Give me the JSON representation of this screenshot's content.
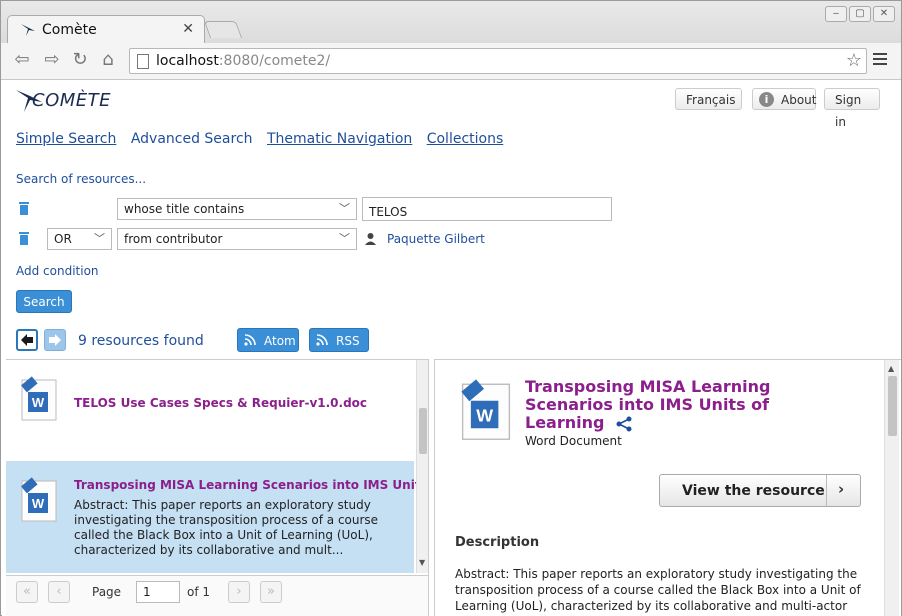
{
  "browser": {
    "tab_title": "Comète",
    "tab_close": "✕",
    "url_host": "localhost",
    "url_rest": ":8080/comete2/"
  },
  "header": {
    "logo_text": "COMÈTE",
    "lang_button": "Français",
    "about_button": "About",
    "signin_button": "Sign in"
  },
  "nav": {
    "simple_search": "Simple Search",
    "advanced_search": "Advanced Search",
    "thematic_navigation": "Thematic Navigation",
    "collections": "Collections"
  },
  "search": {
    "heading": "Search of resources...",
    "row1_field": "whose title contains",
    "row1_value": "TELOS",
    "row2_operator": "OR",
    "row2_field": "from contributor",
    "row2_contributor": "Paquette Gilbert",
    "add_condition": "Add condition",
    "search_button": "Search"
  },
  "results_bar": {
    "found_text": "9 resources found",
    "atom_button": "Atom",
    "rss_button": "RSS"
  },
  "results": [
    {
      "title": "TELOS Use Cases Specs & Requier-v1.0.doc",
      "abstract": ""
    },
    {
      "title": "Transposing MISA Learning Scenarios into IMS Units of Learning",
      "abstract": "Abstract: This paper reports an exploratory study investigating the transposition process of a course called the Black Box into a Unit of Learning (UoL), characterized by its collaborative and mult..."
    }
  ],
  "pager": {
    "page_label": "Page",
    "page_value": "1",
    "of_label": "of 1"
  },
  "detail": {
    "title": "Transposing MISA Learning Scenarios into IMS Units of Learning",
    "type": "Word Document",
    "view_button": "View the resource",
    "description_heading": "Description",
    "description_text": "Abstract: This paper reports an exploratory study investigating the transposition process of a course called the Black Box into a Unit of Learning (UoL), characterized by its collaborative and multi-actor"
  },
  "colors": {
    "link": "#1f4e9c",
    "result_title": "#8b1f8b",
    "primary_button": "#3a8fd6",
    "selected_row": "#c5dff3"
  }
}
